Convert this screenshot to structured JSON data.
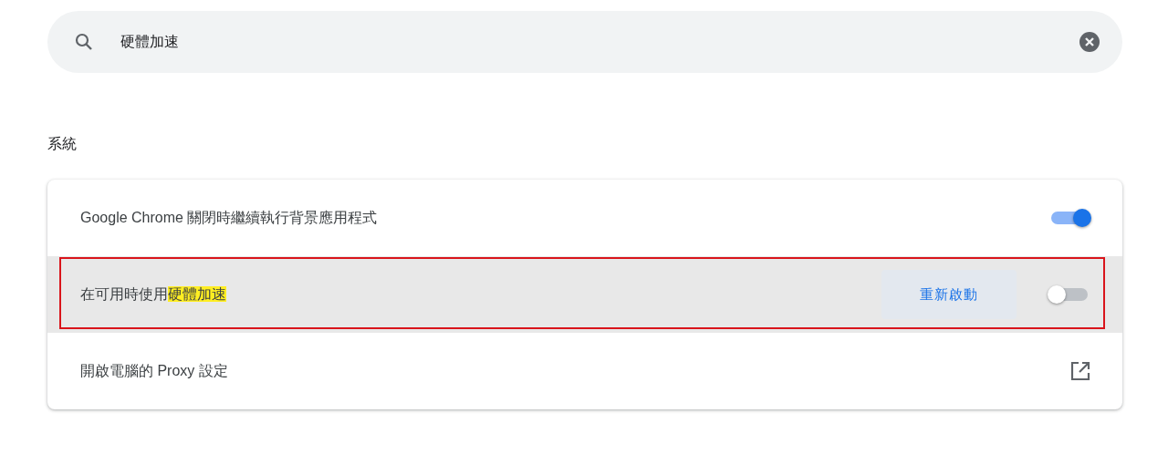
{
  "search": {
    "value": "硬體加速"
  },
  "section": {
    "title": "系統"
  },
  "rows": [
    {
      "kind": "toggle",
      "label": "Google Chrome 關閉時繼續執行背景應用程式",
      "on": true,
      "highlighted": false,
      "outlined": false
    },
    {
      "kind": "toggle",
      "label": "在可用時使用",
      "match": "硬體加速",
      "button": "重新啟動",
      "on": false,
      "highlighted": true,
      "outlined": true
    },
    {
      "kind": "link",
      "label": "開啟電腦的 Proxy 設定",
      "highlighted": false,
      "outlined": false
    }
  ]
}
